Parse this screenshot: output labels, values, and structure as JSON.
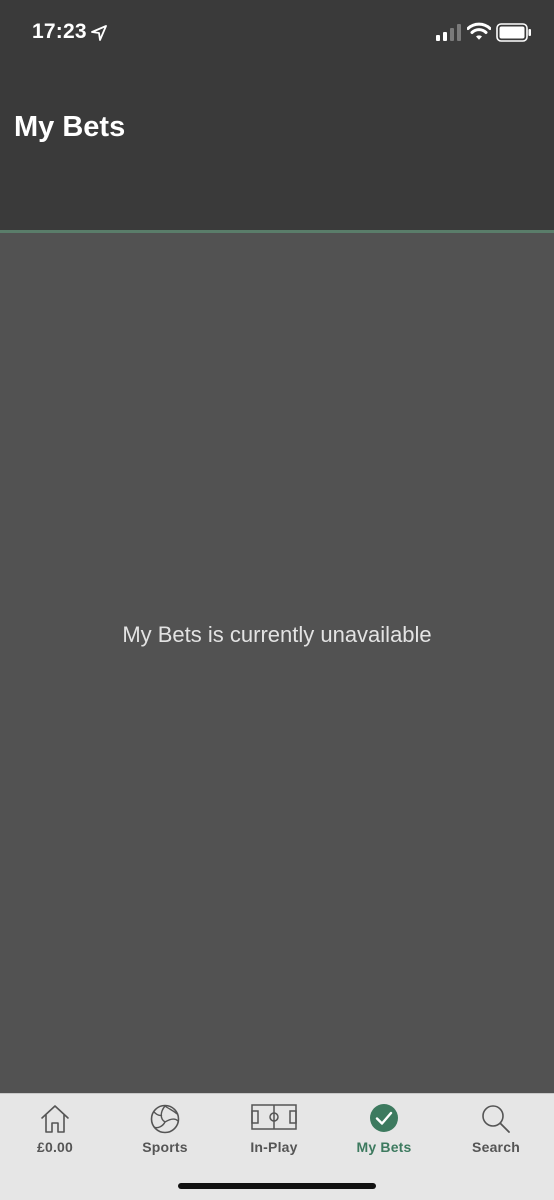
{
  "status_bar": {
    "time": "17:23",
    "location_icon": "location-arrow-icon",
    "signal_icon": "cellular-signal-icon",
    "wifi_icon": "wifi-icon",
    "battery_icon": "battery-icon"
  },
  "header": {
    "title": "My Bets"
  },
  "content": {
    "message": "My Bets is currently unavailable"
  },
  "tab_bar": {
    "tabs": [
      {
        "label": "£0.00",
        "icon": "home-icon",
        "active": false
      },
      {
        "label": "Sports",
        "icon": "football-icon",
        "active": false
      },
      {
        "label": "In-Play",
        "icon": "pitch-icon",
        "active": false
      },
      {
        "label": "My Bets",
        "icon": "check-circle-icon",
        "active": true
      },
      {
        "label": "Search",
        "icon": "search-icon",
        "active": false
      }
    ]
  },
  "colors": {
    "header_bg": "#3a3a3a",
    "content_bg": "#525252",
    "tab_bar_bg": "#e6e6e6",
    "accent": "#3d7a5f",
    "divider": "#5a7d6a"
  }
}
